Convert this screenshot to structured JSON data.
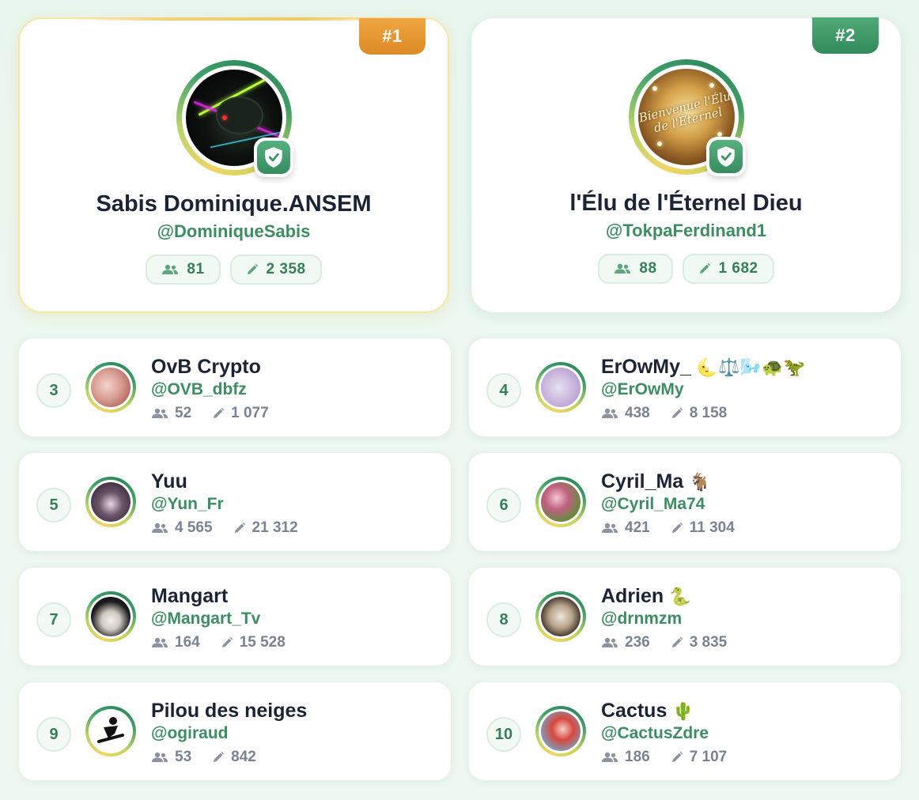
{
  "podium": [
    {
      "rank_label": "#1",
      "name": "Sabis Dominique.ANSEM",
      "handle": "@DominiqueSabis",
      "followers": "81",
      "posts": "2 358",
      "tier": "gold",
      "verified": true
    },
    {
      "rank_label": "#2",
      "name": "l'Élu de l'Éternel Dieu",
      "handle": "@TokpaFerdinand1",
      "followers": "88",
      "posts": "1 682",
      "tier": "green",
      "verified": true
    }
  ],
  "gold_avatar_text": "Bienvenue l'Élu de l'Éternel",
  "leaderboard": [
    {
      "rank": "3",
      "name": "OvB Crypto",
      "handle": "@OVB_dbfz",
      "followers": "52",
      "posts": "1 077"
    },
    {
      "rank": "4",
      "name": "ErOwMy_",
      "name_emoji": "🌜⚖️🌬️🐢🦖",
      "handle": "@ErOwMy",
      "followers": "438",
      "posts": "8 158"
    },
    {
      "rank": "5",
      "name": "Yuu",
      "handle": "@Yun_Fr",
      "followers": "4 565",
      "posts": "21 312"
    },
    {
      "rank": "6",
      "name": "Cyril_Ma",
      "name_emoji": "🐐",
      "handle": "@Cyril_Ma74",
      "followers": "421",
      "posts": "11 304"
    },
    {
      "rank": "7",
      "name": "Mangart",
      "handle": "@Mangart_Tv",
      "followers": "164",
      "posts": "15 528"
    },
    {
      "rank": "8",
      "name": "Adrien",
      "name_emoji": "🐍",
      "handle": "@drnmzm",
      "followers": "236",
      "posts": "3 835"
    },
    {
      "rank": "9",
      "name": "Pilou des neiges",
      "handle": "@ogiraud",
      "followers": "53",
      "posts": "842"
    },
    {
      "rank": "10",
      "name": "Cactus",
      "name_emoji": "🌵",
      "handle": "@CactusZdre",
      "followers": "186",
      "posts": "7 107"
    }
  ],
  "icons": {
    "followers": "people-icon",
    "posts": "pencil-icon",
    "verified": "shield-check-icon"
  },
  "colors": {
    "accent_green": "#3c8d61",
    "gold_tab": "#e39530",
    "green_tab": "#3f9a68",
    "name_text": "#1b2436",
    "stat_text": "#7a8392",
    "background": "#ebf7ef"
  }
}
